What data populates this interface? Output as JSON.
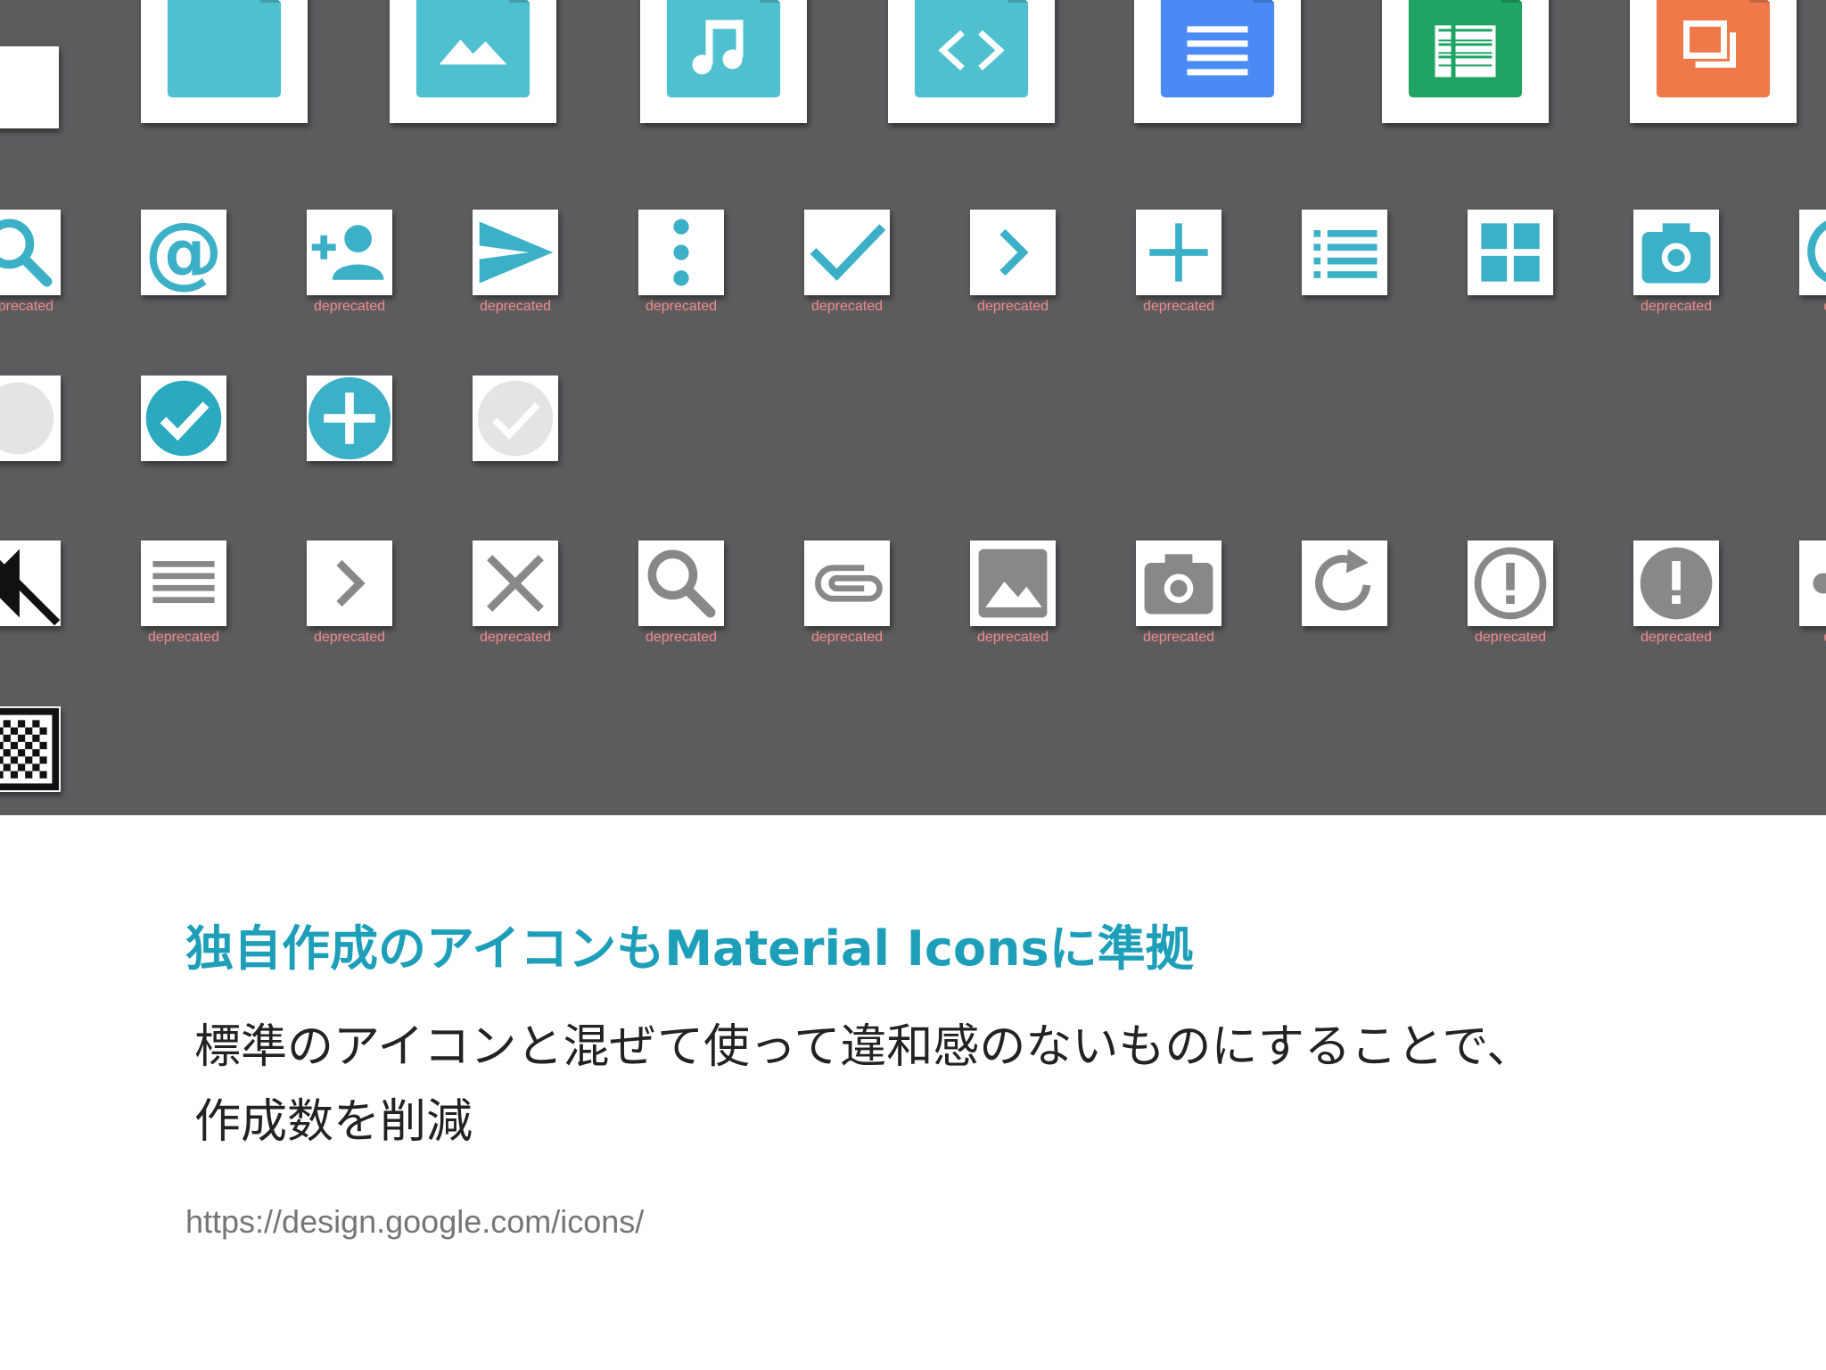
{
  "panel": {
    "background_color": "#5c5c5f",
    "tile_color": "#ffffff",
    "deprecated_label_color": "#f28a8a",
    "rows": [
      {
        "name": "file-type-icons",
        "tiles": [
          {
            "icon": "blank-tile-icon",
            "color": "#ffffff"
          },
          {
            "icon": "file-icon",
            "color": "#4fc0cf"
          },
          {
            "icon": "image-file-icon",
            "color": "#4fc0cf"
          },
          {
            "icon": "audio-file-icon",
            "color": "#4fc0cf"
          },
          {
            "icon": "code-file-icon",
            "color": "#4fc0cf"
          },
          {
            "icon": "docs-file-icon",
            "color": "#4a8af4"
          },
          {
            "icon": "sheets-file-icon",
            "color": "#1fa463"
          },
          {
            "icon": "slides-file-icon",
            "color": "#f0794a"
          }
        ]
      },
      {
        "name": "teal-action-icons",
        "tiles": [
          {
            "icon": "search-icon",
            "color": "#3bb0c6",
            "label": "deprecated"
          },
          {
            "icon": "at-sign-icon",
            "color": "#3bb0c6"
          },
          {
            "icon": "add-person-icon",
            "color": "#3bb0c6",
            "label": "deprecated"
          },
          {
            "icon": "send-icon",
            "color": "#3bb0c6",
            "label": "deprecated"
          },
          {
            "icon": "more-vertical-icon",
            "color": "#3bb0c6",
            "label": "deprecated"
          },
          {
            "icon": "check-icon",
            "color": "#3bb0c6",
            "label": "deprecated"
          },
          {
            "icon": "chevron-right-icon",
            "color": "#3bb0c6",
            "label": "deprecated"
          },
          {
            "icon": "plus-icon",
            "color": "#3bb0c6",
            "label": "deprecated"
          },
          {
            "icon": "list-icon",
            "color": "#3bb0c6"
          },
          {
            "icon": "grid-view-icon",
            "color": "#3bb0c6"
          },
          {
            "icon": "camera-icon",
            "color": "#3bb0c6",
            "label": "deprecated"
          },
          {
            "icon": "circle-partial-icon",
            "color": "#3bb0c6",
            "label": "depre"
          }
        ]
      },
      {
        "name": "circle-state-icons",
        "tiles": [
          {
            "icon": "empty-circle-icon",
            "color": "#e4e4e6"
          },
          {
            "icon": "check-circle-icon",
            "color": "#2aa9bf"
          },
          {
            "icon": "add-circle-icon",
            "color": "#3bb0c6"
          },
          {
            "icon": "check-circle-disabled-icon",
            "color": "#e4e4e6"
          }
        ]
      },
      {
        "name": "grey-action-icons",
        "tiles": [
          {
            "icon": "volume-mute-icon",
            "color": "#111111"
          },
          {
            "icon": "menu-icon",
            "color": "#888888",
            "label": "deprecated"
          },
          {
            "icon": "chevron-right-icon",
            "color": "#888888",
            "label": "deprecated"
          },
          {
            "icon": "close-icon",
            "color": "#888888",
            "label": "deprecated"
          },
          {
            "icon": "search-icon",
            "color": "#888888",
            "label": "deprecated"
          },
          {
            "icon": "attachment-icon",
            "color": "#888888",
            "label": "deprecated"
          },
          {
            "icon": "image-icon",
            "color": "#888888",
            "label": "deprecated"
          },
          {
            "icon": "camera-icon",
            "color": "#888888",
            "label": "deprecated"
          },
          {
            "icon": "refresh-icon",
            "color": "#888888"
          },
          {
            "icon": "error-outline-icon",
            "color": "#888888",
            "label": "deprecated"
          },
          {
            "icon": "error-filled-icon",
            "color": "#888888",
            "label": "deprecated"
          },
          {
            "icon": "share-icon",
            "color": "#888888",
            "label": "depre"
          }
        ]
      },
      {
        "name": "misc-icons",
        "tiles": [
          {
            "icon": "checkerboard-icon",
            "color": "#111111"
          }
        ]
      }
    ]
  },
  "slide": {
    "heading": "独自作成のアイコンもMaterial Iconsに準拠",
    "heading_color": "#1e9fb9",
    "body_lines": [
      "標準のアイコンと混ぜて使って違和感のないものにすることで、",
      "作成数を削減"
    ],
    "source_url": "https://design.google.com/icons/"
  }
}
